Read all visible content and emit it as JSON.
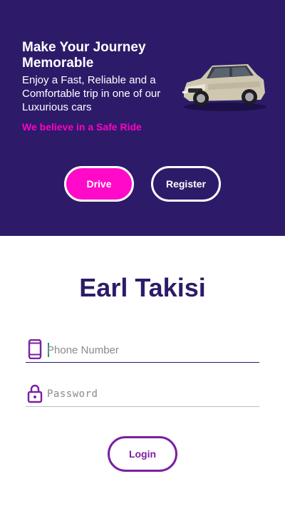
{
  "hero": {
    "title": "Make Your Journey Memorable",
    "description": "Enjoy a Fast, Reliable and a Comfortable trip in one of our Luxurious cars",
    "tagline": "We believe in a Safe Ride",
    "drive_label": "Drive",
    "register_label": "Register"
  },
  "brand": {
    "name": "Earl Takisi"
  },
  "form": {
    "phone_placeholder": "Phone Number",
    "phone_icon": "smartphone-icon",
    "password_placeholder": "Password",
    "password_icon": "lock-icon",
    "login_label": "Login"
  },
  "colors": {
    "hero_bg": "#2d1b69",
    "accent_pink": "#ff0ac8",
    "brand_purple": "#7b1fa2"
  }
}
